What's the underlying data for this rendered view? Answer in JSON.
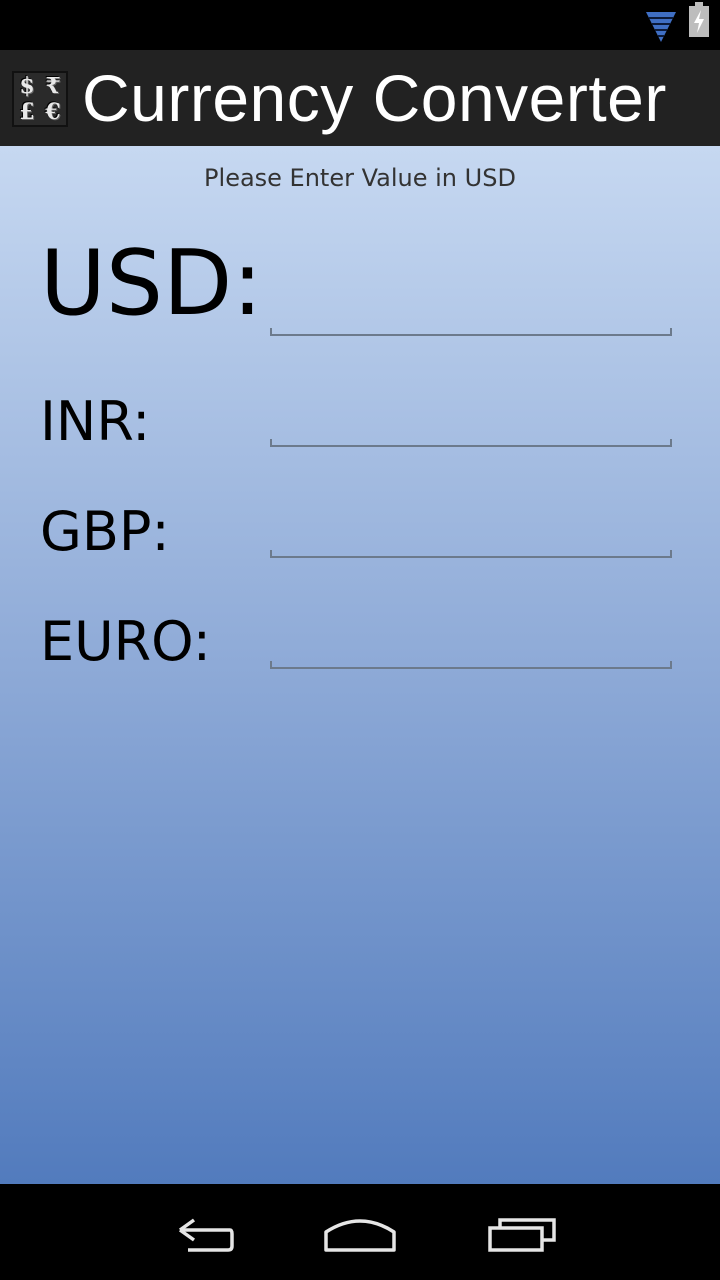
{
  "status_bar": {
    "icons": [
      "wifi-icon",
      "battery-charging-icon"
    ]
  },
  "app": {
    "title": "Currency Converter",
    "icon": "currency-symbols-icon",
    "icon_glyphs": [
      "$",
      "₹",
      "£",
      "€"
    ]
  },
  "prompt": "Please Enter Value in USD",
  "fields": {
    "usd": {
      "label": "USD:",
      "value": ""
    },
    "inr": {
      "label": "INR:",
      "value": ""
    },
    "gbp": {
      "label": "GBP:",
      "value": ""
    },
    "euro": {
      "label": "EURO:",
      "value": ""
    }
  },
  "nav_bar": {
    "buttons": [
      "back-icon",
      "home-icon",
      "recent-apps-icon"
    ]
  },
  "colors": {
    "action_bar": "#222222",
    "gradient_top": "#c6d8f1",
    "gradient_bottom": "#527bbd",
    "wifi": "#3f6fc4"
  }
}
